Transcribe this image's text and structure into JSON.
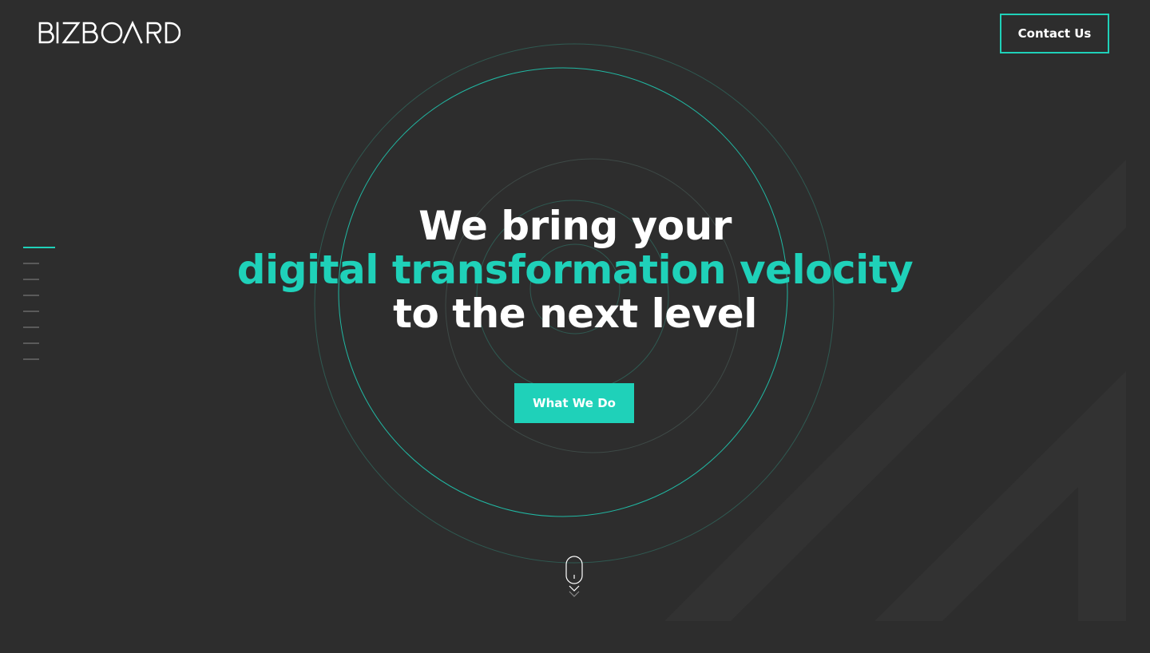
{
  "brand": {
    "logo_text": "BIZBOARD"
  },
  "header": {
    "contact_label": "Contact Us"
  },
  "hero": {
    "line1": "We bring your",
    "line2": "digital transformation velocity",
    "line3": "to the next level",
    "cta_label": "What We Do"
  },
  "slide_nav": {
    "count": 8,
    "active_index": 0
  },
  "colors": {
    "background": "#2d2d2d",
    "accent": "#1fd1b9",
    "text": "#ffffff"
  },
  "icons": {
    "scroll": "mouse-scroll-icon"
  }
}
